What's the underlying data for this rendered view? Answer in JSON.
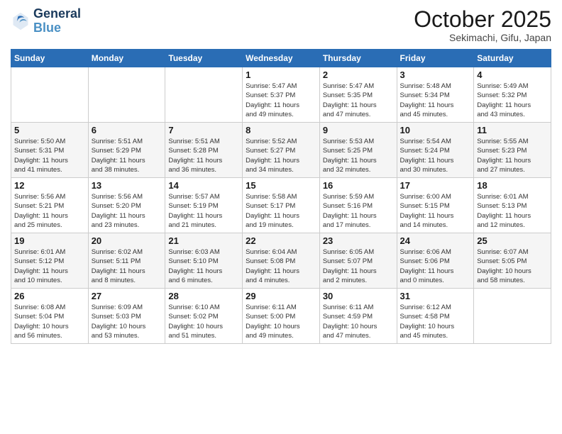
{
  "header": {
    "logo_line1": "General",
    "logo_line2": "Blue",
    "month": "October 2025",
    "location": "Sekimachi, Gifu, Japan"
  },
  "weekdays": [
    "Sunday",
    "Monday",
    "Tuesday",
    "Wednesday",
    "Thursday",
    "Friday",
    "Saturday"
  ],
  "weeks": [
    [
      {
        "day": "",
        "info": ""
      },
      {
        "day": "",
        "info": ""
      },
      {
        "day": "",
        "info": ""
      },
      {
        "day": "1",
        "info": "Sunrise: 5:47 AM\nSunset: 5:37 PM\nDaylight: 11 hours\nand 49 minutes."
      },
      {
        "day": "2",
        "info": "Sunrise: 5:47 AM\nSunset: 5:35 PM\nDaylight: 11 hours\nand 47 minutes."
      },
      {
        "day": "3",
        "info": "Sunrise: 5:48 AM\nSunset: 5:34 PM\nDaylight: 11 hours\nand 45 minutes."
      },
      {
        "day": "4",
        "info": "Sunrise: 5:49 AM\nSunset: 5:32 PM\nDaylight: 11 hours\nand 43 minutes."
      }
    ],
    [
      {
        "day": "5",
        "info": "Sunrise: 5:50 AM\nSunset: 5:31 PM\nDaylight: 11 hours\nand 41 minutes."
      },
      {
        "day": "6",
        "info": "Sunrise: 5:51 AM\nSunset: 5:29 PM\nDaylight: 11 hours\nand 38 minutes."
      },
      {
        "day": "7",
        "info": "Sunrise: 5:51 AM\nSunset: 5:28 PM\nDaylight: 11 hours\nand 36 minutes."
      },
      {
        "day": "8",
        "info": "Sunrise: 5:52 AM\nSunset: 5:27 PM\nDaylight: 11 hours\nand 34 minutes."
      },
      {
        "day": "9",
        "info": "Sunrise: 5:53 AM\nSunset: 5:25 PM\nDaylight: 11 hours\nand 32 minutes."
      },
      {
        "day": "10",
        "info": "Sunrise: 5:54 AM\nSunset: 5:24 PM\nDaylight: 11 hours\nand 30 minutes."
      },
      {
        "day": "11",
        "info": "Sunrise: 5:55 AM\nSunset: 5:23 PM\nDaylight: 11 hours\nand 27 minutes."
      }
    ],
    [
      {
        "day": "12",
        "info": "Sunrise: 5:56 AM\nSunset: 5:21 PM\nDaylight: 11 hours\nand 25 minutes."
      },
      {
        "day": "13",
        "info": "Sunrise: 5:56 AM\nSunset: 5:20 PM\nDaylight: 11 hours\nand 23 minutes."
      },
      {
        "day": "14",
        "info": "Sunrise: 5:57 AM\nSunset: 5:19 PM\nDaylight: 11 hours\nand 21 minutes."
      },
      {
        "day": "15",
        "info": "Sunrise: 5:58 AM\nSunset: 5:17 PM\nDaylight: 11 hours\nand 19 minutes."
      },
      {
        "day": "16",
        "info": "Sunrise: 5:59 AM\nSunset: 5:16 PM\nDaylight: 11 hours\nand 17 minutes."
      },
      {
        "day": "17",
        "info": "Sunrise: 6:00 AM\nSunset: 5:15 PM\nDaylight: 11 hours\nand 14 minutes."
      },
      {
        "day": "18",
        "info": "Sunrise: 6:01 AM\nSunset: 5:13 PM\nDaylight: 11 hours\nand 12 minutes."
      }
    ],
    [
      {
        "day": "19",
        "info": "Sunrise: 6:01 AM\nSunset: 5:12 PM\nDaylight: 11 hours\nand 10 minutes."
      },
      {
        "day": "20",
        "info": "Sunrise: 6:02 AM\nSunset: 5:11 PM\nDaylight: 11 hours\nand 8 minutes."
      },
      {
        "day": "21",
        "info": "Sunrise: 6:03 AM\nSunset: 5:10 PM\nDaylight: 11 hours\nand 6 minutes."
      },
      {
        "day": "22",
        "info": "Sunrise: 6:04 AM\nSunset: 5:08 PM\nDaylight: 11 hours\nand 4 minutes."
      },
      {
        "day": "23",
        "info": "Sunrise: 6:05 AM\nSunset: 5:07 PM\nDaylight: 11 hours\nand 2 minutes."
      },
      {
        "day": "24",
        "info": "Sunrise: 6:06 AM\nSunset: 5:06 PM\nDaylight: 11 hours\nand 0 minutes."
      },
      {
        "day": "25",
        "info": "Sunrise: 6:07 AM\nSunset: 5:05 PM\nDaylight: 10 hours\nand 58 minutes."
      }
    ],
    [
      {
        "day": "26",
        "info": "Sunrise: 6:08 AM\nSunset: 5:04 PM\nDaylight: 10 hours\nand 56 minutes."
      },
      {
        "day": "27",
        "info": "Sunrise: 6:09 AM\nSunset: 5:03 PM\nDaylight: 10 hours\nand 53 minutes."
      },
      {
        "day": "28",
        "info": "Sunrise: 6:10 AM\nSunset: 5:02 PM\nDaylight: 10 hours\nand 51 minutes."
      },
      {
        "day": "29",
        "info": "Sunrise: 6:11 AM\nSunset: 5:00 PM\nDaylight: 10 hours\nand 49 minutes."
      },
      {
        "day": "30",
        "info": "Sunrise: 6:11 AM\nSunset: 4:59 PM\nDaylight: 10 hours\nand 47 minutes."
      },
      {
        "day": "31",
        "info": "Sunrise: 6:12 AM\nSunset: 4:58 PM\nDaylight: 10 hours\nand 45 minutes."
      },
      {
        "day": "",
        "info": ""
      }
    ]
  ]
}
